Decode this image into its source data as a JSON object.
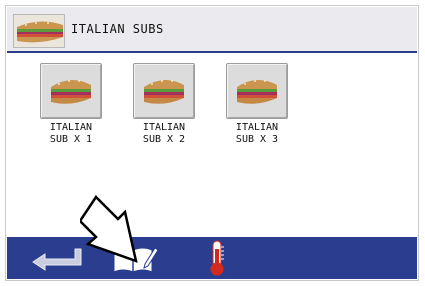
{
  "header": {
    "title": "ITALIAN SUBS",
    "thumbnail_icon": "sandwich-icon"
  },
  "items": [
    {
      "label_line1": "ITALIAN",
      "label_line2": "SUB X 1",
      "icon": "sandwich-icon"
    },
    {
      "label_line1": "ITALIAN",
      "label_line2": "SUB X 2",
      "icon": "sandwich-icon"
    },
    {
      "label_line1": "ITALIAN",
      "label_line2": "SUB X 3",
      "icon": "sandwich-icon"
    }
  ],
  "toolbar": {
    "back_icon": "back-arrow-icon",
    "recipe_icon": "recipe-book-edit-icon",
    "temperature_icon": "thermometer-icon"
  },
  "colors": {
    "bar_blue": "#2b3d8f",
    "header_bg": "#ebebef",
    "tile_bg": "#dcdcdc",
    "thermometer_red": "#d42a1e"
  }
}
